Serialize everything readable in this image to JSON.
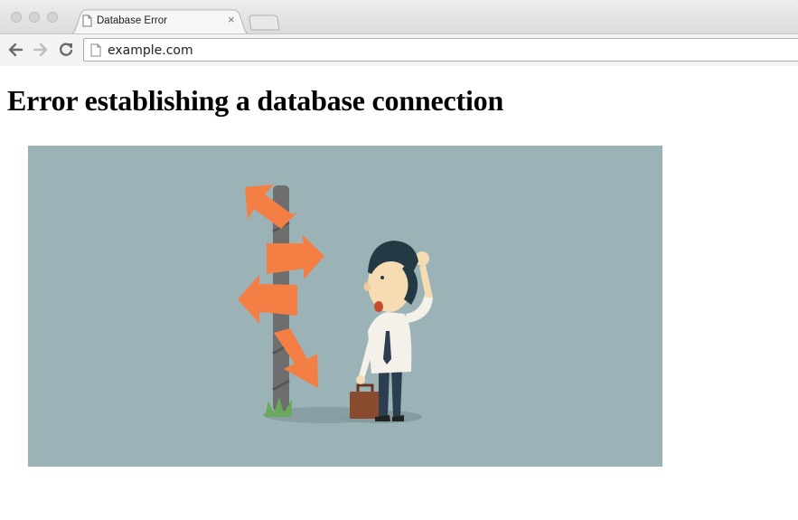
{
  "browser": {
    "tab": {
      "title": "Database Error",
      "close_glyph": "×"
    },
    "address_bar": {
      "url": "example.com"
    },
    "icons": {
      "back": "back-arrow-icon",
      "forward": "forward-arrow-icon",
      "reload": "reload-icon",
      "page": "document-icon"
    }
  },
  "page": {
    "heading": "Error establishing a database connection",
    "illustration": {
      "subject": "confused-businessman-at-signpost",
      "colors": {
        "background": "#9bb3b7",
        "arrows": "#f37f45",
        "pole": "#6e6e6e"
      }
    }
  }
}
